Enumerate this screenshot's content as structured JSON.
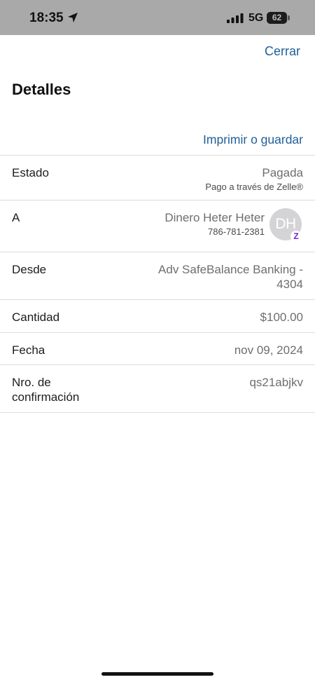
{
  "status_bar": {
    "time": "18:35",
    "network": "5G",
    "battery": "62",
    "icons": [
      "location-arrow-icon",
      "signal-bars-icon",
      "battery-icon"
    ]
  },
  "header": {
    "close_label": "Cerrar",
    "title": "Detalles",
    "print_label": "Imprimir o guardar"
  },
  "details": {
    "status": {
      "label": "Estado",
      "value": "Pagada",
      "sub": "Pago a través de Zelle®"
    },
    "to": {
      "label": "A",
      "name": "Dinero Heter Heter",
      "phone": "786-781-2381",
      "initials": "DH",
      "badge": "Z"
    },
    "from": {
      "label": "Desde",
      "value_line1": "Adv SafeBalance Banking -",
      "value_line2": "4304"
    },
    "amount": {
      "label": "Cantidad",
      "value": "$100.00"
    },
    "date": {
      "label": "Fecha",
      "value": "nov 09, 2024"
    },
    "confirmation": {
      "label_line1": "Nro. de",
      "label_line2": "confirmación",
      "value": "qs21abjkv"
    }
  },
  "colors": {
    "accent": "#1f5f98",
    "zelle": "#6d1ed4",
    "status_bar_bg": "#a9a9a9"
  }
}
